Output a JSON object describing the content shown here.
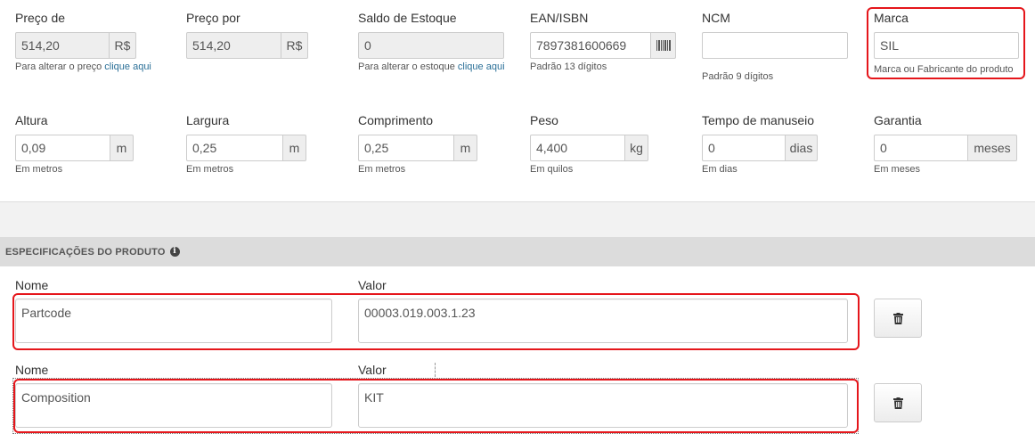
{
  "row1": {
    "preco_de": {
      "label": "Preço de",
      "value": "514,20",
      "addon": "R$",
      "help_text": "Para alterar o preço",
      "help_link": "clique aqui"
    },
    "preco_por": {
      "label": "Preço por",
      "value": "514,20",
      "addon": "R$"
    },
    "saldo": {
      "label": "Saldo de Estoque",
      "value": "0",
      "help_text": "Para alterar o estoque",
      "help_link": "clique aqui"
    },
    "ean": {
      "label": "EAN/ISBN",
      "value": "7897381600669",
      "icon": "barcode-icon",
      "help": "Padrão 13 dígitos"
    },
    "ncm": {
      "label": "NCM",
      "value": "",
      "help": "Padrão 9 dígitos"
    },
    "marca": {
      "label": "Marca",
      "value": "SIL",
      "help": "Marca ou Fabricante do produto"
    }
  },
  "row2": {
    "altura": {
      "label": "Altura",
      "value": "0,09",
      "addon": "m",
      "help": "Em metros"
    },
    "largura": {
      "label": "Largura",
      "value": "0,25",
      "addon": "m",
      "help": "Em metros"
    },
    "comprimento": {
      "label": "Comprimento",
      "value": "0,25",
      "addon": "m",
      "help": "Em metros"
    },
    "peso": {
      "label": "Peso",
      "value": "4,400",
      "addon": "kg",
      "help": "Em quilos"
    },
    "manuseio": {
      "label": "Tempo de manuseio",
      "value": "0",
      "addon": "dias",
      "help": "Em dias"
    },
    "garantia": {
      "label": "Garantia",
      "value": "0",
      "addon": "meses",
      "help": "Em meses"
    }
  },
  "specs": {
    "title": "ESPECIFICAÇÕES DO PRODUTO",
    "info_icon": "info-circle-icon",
    "delete_icon": "trash-icon",
    "highlight_color": "#e5161b",
    "rows": [
      {
        "name_label": "Nome",
        "value_label": "Valor",
        "name": "Partcode",
        "value": "00003.019.003.1.23"
      },
      {
        "name_label": "Nome",
        "value_label": "Valor",
        "name": "Composition",
        "value": "KIT"
      }
    ]
  }
}
